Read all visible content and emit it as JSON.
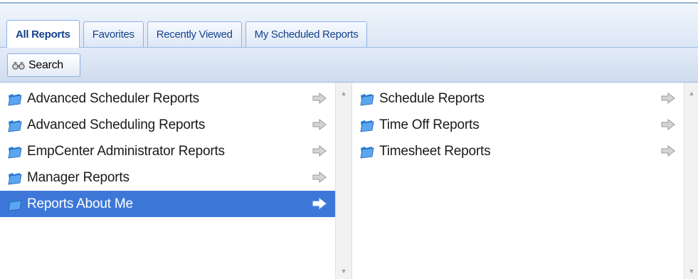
{
  "tabs": [
    {
      "label": "All Reports",
      "active": true
    },
    {
      "label": "Favorites",
      "active": false
    },
    {
      "label": "Recently Viewed",
      "active": false
    },
    {
      "label": "My Scheduled Reports",
      "active": false
    }
  ],
  "toolbar": {
    "search_label": "Search",
    "search_icon": "binoculars-icon"
  },
  "left_list": {
    "items": [
      {
        "label": "Advanced Scheduler Reports",
        "selected": false
      },
      {
        "label": "Advanced Scheduling Reports",
        "selected": false
      },
      {
        "label": "EmpCenter Administrator Reports",
        "selected": false
      },
      {
        "label": "Manager Reports",
        "selected": false
      },
      {
        "label": "Reports About Me",
        "selected": true
      }
    ]
  },
  "right_list": {
    "items": [
      {
        "label": "Schedule Reports",
        "selected": false
      },
      {
        "label": "Time Off Reports",
        "selected": false
      },
      {
        "label": "Timesheet Reports",
        "selected": false
      }
    ]
  },
  "colors": {
    "selected_row": "#3d78d8",
    "tab_text": "#15428b",
    "folder": "#3a8ee6",
    "arrow": "#c9c9c9"
  },
  "icons": {
    "folder": "folder-icon",
    "arrow": "arrow-right-icon",
    "scroll_up": "scroll-up-arrow",
    "scroll_down": "scroll-down-arrow"
  }
}
